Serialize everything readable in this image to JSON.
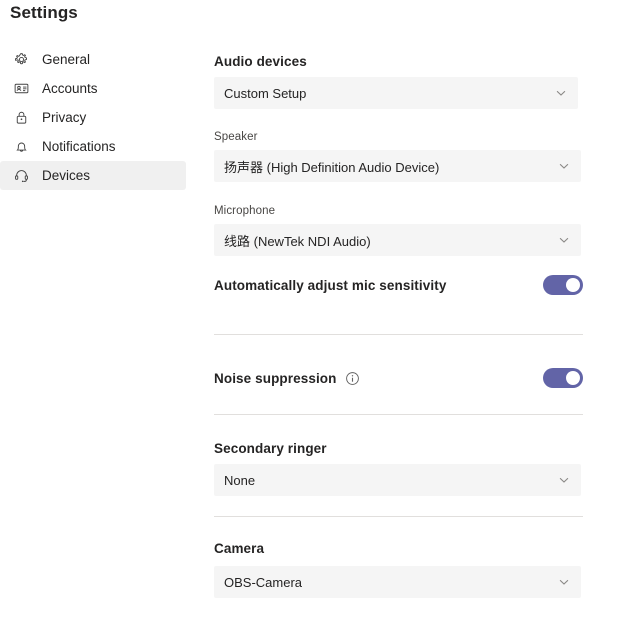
{
  "window": {
    "title": "Settings"
  },
  "sidebar": {
    "items": [
      {
        "label": "General",
        "icon": "gear-icon",
        "selected": false
      },
      {
        "label": "Accounts",
        "icon": "contact-card-icon",
        "selected": false
      },
      {
        "label": "Privacy",
        "icon": "lock-icon",
        "selected": false
      },
      {
        "label": "Notifications",
        "icon": "bell-icon",
        "selected": false
      },
      {
        "label": "Devices",
        "icon": "headset-icon",
        "selected": true
      }
    ]
  },
  "main": {
    "audio_devices": {
      "title": "Audio devices",
      "setup_value": "Custom Setup",
      "speaker_label": "Speaker",
      "speaker_value": "扬声器 (High Definition Audio Device)",
      "microphone_label": "Microphone",
      "microphone_value": "线路 (NewTek NDI Audio)"
    },
    "auto_mic": {
      "label": "Automatically adjust mic sensitivity",
      "toggle_state": "on"
    },
    "noise_suppression": {
      "label": "Noise suppression",
      "info_icon": "info-icon",
      "toggle_state": "on"
    },
    "secondary_ringer": {
      "title": "Secondary ringer",
      "value": "None"
    },
    "camera": {
      "title": "Camera",
      "value": "OBS-Camera"
    }
  },
  "colors": {
    "accent": "#6264a7",
    "field_background": "#f5f5f5",
    "selected_nav_background": "#f0f0f0",
    "divider": "#e1dfdd"
  }
}
